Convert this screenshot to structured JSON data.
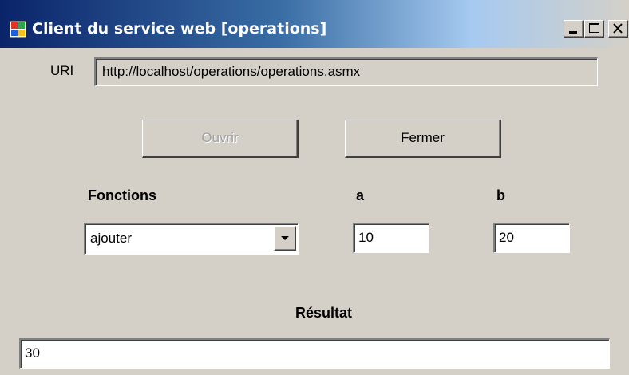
{
  "window": {
    "title": "Client du service web [operations]",
    "icon": "windows-app-icon",
    "controls": [
      "minimize-icon",
      "maximize-icon",
      "close-icon"
    ]
  },
  "uri": {
    "label": "URI",
    "value": "http://localhost/operations/operations.asmx"
  },
  "buttons": {
    "open_label": "Ouvrir",
    "open_enabled": false,
    "close_label": "Fermer",
    "close_enabled": true
  },
  "fonctions": {
    "label": "Fonctions",
    "selected": "ajouter"
  },
  "param_a": {
    "label": "a",
    "value": "10"
  },
  "param_b": {
    "label": "b",
    "value": "20"
  },
  "resultat": {
    "label": "Résultat",
    "value": "30"
  },
  "colors": {
    "face": "#d4d0c8",
    "title_start": "#0a246a",
    "title_end": "#a6caf0",
    "disabled_text": "#a0a0a0"
  }
}
